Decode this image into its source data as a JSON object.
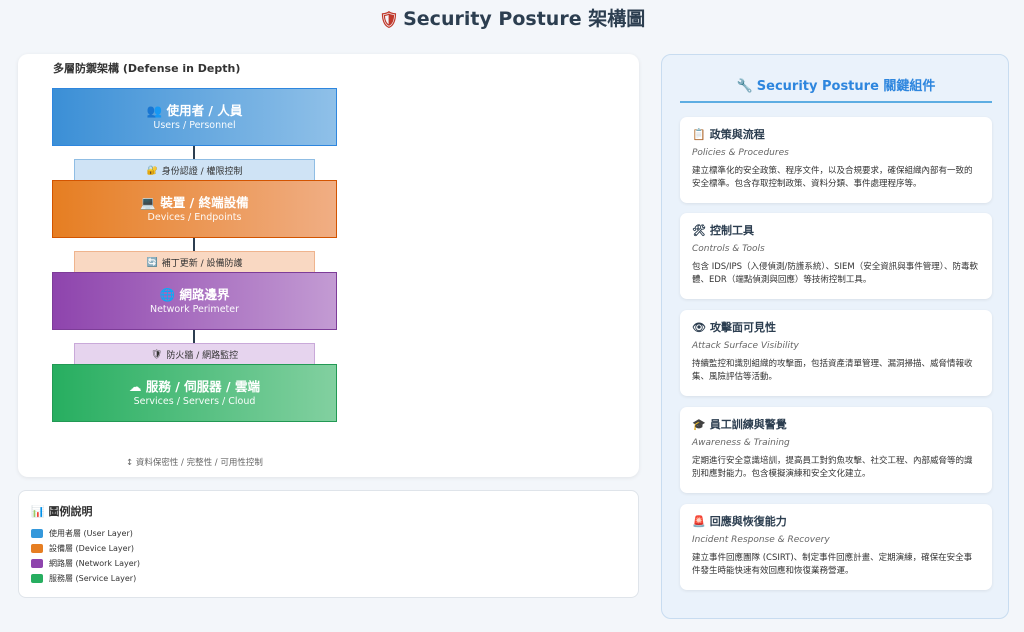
{
  "header": {
    "icon": "shield-icon",
    "title": "Security Posture 架構圖"
  },
  "diagram": {
    "title": "多層防禦架構 (Defense in Depth)",
    "layers": [
      {
        "icon": "users-icon",
        "glyph": "👥",
        "title": "使用者 / 人員",
        "subtitle": "Users / Personnel",
        "color": "#3b8fd6"
      },
      {
        "icon": "computer-icon",
        "glyph": "💻",
        "title": "裝置 / 終端設備",
        "subtitle": "Devices / Endpoints",
        "color": "#e67e22"
      },
      {
        "icon": "globe-icon",
        "glyph": "🌐",
        "title": "網路邊界",
        "subtitle": "Network Perimeter",
        "color": "#8e44ad"
      },
      {
        "icon": "cloud-icon",
        "glyph": "☁",
        "title": "服務 / 伺服器 / 雲端",
        "subtitle": "Services / Servers / Cloud",
        "color": "#27ae60"
      }
    ],
    "controls": [
      {
        "icon": "lock-key-icon",
        "glyph": "🔐",
        "label": "身份認證 / 權限控制"
      },
      {
        "icon": "refresh-icon",
        "glyph": "🔄",
        "label": "補丁更新 / 設備防護"
      },
      {
        "icon": "shield-icon",
        "glyph": "🛡",
        "label": "防火牆 / 網路監控"
      }
    ],
    "footer_note": "↕ 資料保密性 / 完整性 / 可用性控制"
  },
  "legend": {
    "icon": "bar-chart-icon",
    "glyph": "📊",
    "title": "圖例說明",
    "items": [
      {
        "label": "使用者層 (User Layer)",
        "color": "#3498db"
      },
      {
        "label": "設備層 (Device Layer)",
        "color": "#e67e22"
      },
      {
        "label": "網路層 (Network Layer)",
        "color": "#8e44ad"
      },
      {
        "label": "服務層 (Service Layer)",
        "color": "#27ae60"
      }
    ]
  },
  "components": {
    "icon": "wrench-icon",
    "glyph": "🔧",
    "title": "Security Posture 關鍵組件",
    "items": [
      {
        "icon": "clipboard-icon",
        "glyph": "📋",
        "title": "政策與流程",
        "subtitle": "Policies & Procedures",
        "description": "建立標準化的安全政策、程序文件，以及合規要求，確保組織內部有一致的安全標準。包含存取控制政策、資料分類、事件處理程序等。"
      },
      {
        "icon": "tools-icon",
        "glyph": "🛠",
        "title": "控制工具",
        "subtitle": "Controls & Tools",
        "description": "包含 IDS/IPS（入侵偵測/防護系統）、SIEM（安全資訊與事件管理）、防毒軟體、EDR（端點偵測與回應）等技術控制工具。"
      },
      {
        "icon": "eye-icon",
        "glyph": "👁",
        "title": "攻擊面可見性",
        "subtitle": "Attack Surface Visibility",
        "description": "持續監控和識別組織的攻擊面，包括資產清單管理、漏洞掃描、威脅情報收集、風險評估等活動。"
      },
      {
        "icon": "graduation-cap-icon",
        "glyph": "🎓",
        "title": "員工訓練與警覺",
        "subtitle": "Awareness & Training",
        "description": "定期進行安全意識培訓，提高員工對釣魚攻擊、社交工程、內部威脅等的識別和應對能力。包含模擬演練和安全文化建立。"
      },
      {
        "icon": "alarm-icon",
        "glyph": "🚨",
        "title": "回應與恢復能力",
        "subtitle": "Incident Response & Recovery",
        "description": "建立事件回應團隊 (CSIRT)、制定事件回應計畫、定期演練，確保在安全事件發生時能快速有效回應和恢復業務營運。"
      }
    ]
  }
}
